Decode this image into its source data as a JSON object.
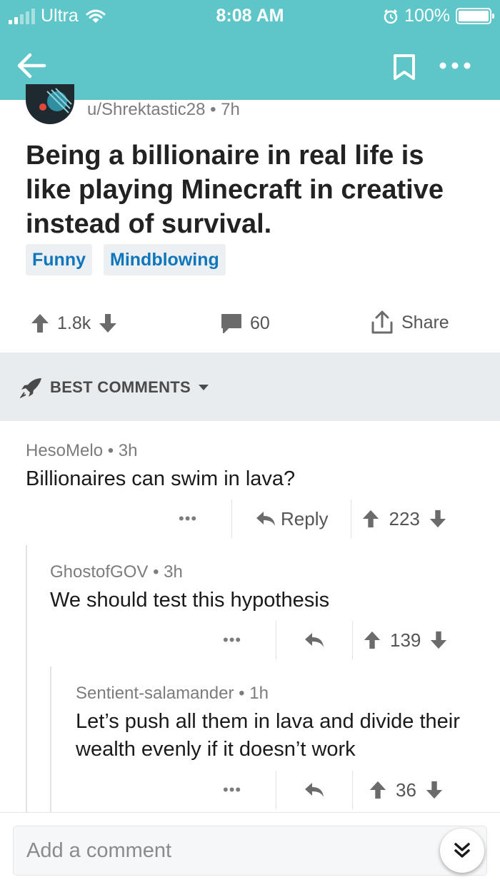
{
  "status_bar": {
    "carrier": "Ultra",
    "time": "8:08 AM",
    "battery": "100%"
  },
  "post": {
    "author": "u/Shrektastic28",
    "age": "7h",
    "title": "Being a billionaire in real life is like playing Minecraft in creative instead of survival.",
    "flairs": [
      "Funny",
      "Mindblowing"
    ],
    "upvotes": "1.8k",
    "comments": "60",
    "share_label": "Share"
  },
  "sort": {
    "label": "BEST COMMENTS"
  },
  "comments": [
    {
      "author": "HesoMelo",
      "age": "3h",
      "body": "Billionaires can swim in lava?",
      "reply_label": "Reply",
      "score": "223"
    },
    {
      "author": "GhostofGOV",
      "age": "3h",
      "body": "We should test this hypothesis",
      "score": "139"
    },
    {
      "author": "Sentient-salamander",
      "age": "1h",
      "body": "Let’s push all them in lava and divide their wealth evenly if it doesn’t work",
      "score": "36"
    }
  ],
  "composer": {
    "placeholder": "Add a comment"
  },
  "colors": {
    "header": "#5ec6c9",
    "flair_text": "#0f76bd",
    "sort_bg": "#e9ecee"
  }
}
